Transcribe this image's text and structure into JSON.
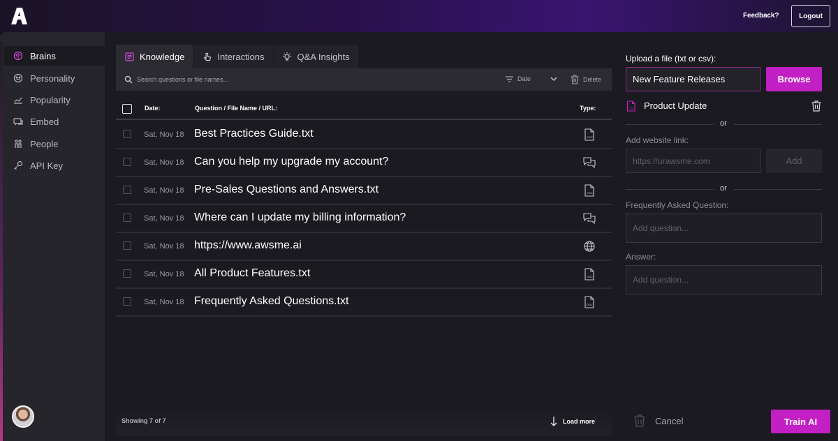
{
  "topbar": {
    "feedback_label": "Feedback?",
    "logout_label": "Logout"
  },
  "sidebar": {
    "items": [
      {
        "label": "Brains",
        "icon": "brain-icon",
        "active": true
      },
      {
        "label": "Personality",
        "icon": "face-icon",
        "active": false
      },
      {
        "label": "Popularity",
        "icon": "chart-icon",
        "active": false
      },
      {
        "label": "Embed",
        "icon": "embed-icon",
        "active": false
      },
      {
        "label": "People",
        "icon": "people-icon",
        "active": false
      },
      {
        "label": "API Key",
        "icon": "key-icon",
        "active": false
      }
    ]
  },
  "tabs": [
    {
      "label": "Knowledge",
      "icon": "book-icon",
      "active": true
    },
    {
      "label": "Interactions",
      "icon": "pointer-icon",
      "active": false
    },
    {
      "label": "Q&A Insights",
      "icon": "lightbulb-icon",
      "active": false
    }
  ],
  "toolbar": {
    "search_placeholder": "Search questions or file names...",
    "sort_label": "Date",
    "delete_label": "Delete"
  },
  "table": {
    "headers": {
      "date": "Date:",
      "name": "Question / File Name / URL:",
      "type": "Type:"
    },
    "rows": [
      {
        "date": "Sat, Nov 18",
        "name": "Best Practices Guide.txt",
        "type": "doc"
      },
      {
        "date": "Sat, Nov 18",
        "name": "Can you help my upgrade my account?",
        "type": "chat"
      },
      {
        "date": "Sat, Nov 18",
        "name": "Pre-Sales Questions and Answers.txt",
        "type": "doc"
      },
      {
        "date": "Sat, Nov 18",
        "name": "Where can I update my billing information?",
        "type": "chat"
      },
      {
        "date": "Sat, Nov 18",
        "name": "https://www.awsme.ai",
        "type": "web"
      },
      {
        "date": "Sat, Nov 18",
        "name": "All Product Features.txt",
        "type": "doc"
      },
      {
        "date": "Sat, Nov 18",
        "name": "Frequently Asked Questions.txt",
        "type": "doc"
      }
    ],
    "showing_label": "Showing 7 of 7",
    "load_more_label": "Load more"
  },
  "right_panel": {
    "upload_label": "Upload a file (txt or csv):",
    "file_input_value": "New Feature Releases",
    "browse_label": "Browse",
    "uploaded_file_name": "Product Update",
    "or_label": "or",
    "website_label": "Add website link:",
    "website_placeholder": "https://urawsme.com",
    "add_label": "Add",
    "faq_label": "Frequently Asked Question:",
    "faq_placeholder": "Add question...",
    "answer_label": "Answer:",
    "answer_placeholder": "Add question...",
    "cancel_label": "Cancel",
    "train_label": "Train AI"
  },
  "colors": {
    "accent": "#c21fc4",
    "background": "#1a1a20",
    "sidebar": "#26252b"
  }
}
